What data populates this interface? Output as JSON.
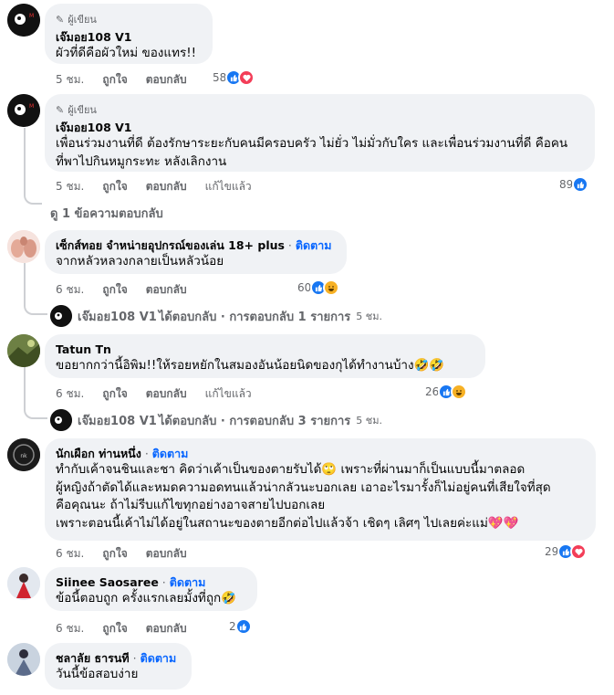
{
  "author_badge": "ผู้เขียน",
  "actions": {
    "like": "ถูกใจ",
    "reply": "ตอบกลับ",
    "edited": "แก้ไขแล้ว",
    "follow": "ติดตาม"
  },
  "comments": [
    {
      "name": "เจ๊มอย108 V1",
      "lines": [
        "ผัวที่ดีคือผัวใหม่ ของแทร!!"
      ],
      "time": "5 ชม.",
      "count": "58"
    },
    {
      "name": "เจ๊มอย108 V1",
      "lines": [
        "เพื่อนร่วมงานที่ดี ต้องรักษาระยะกับคนมีครอบครัว ไม่ยั่ว ไม่มั่วกับใคร และเพื่อนร่วมงานที่ดี คือคน",
        "ที่พาไปกินหมูกระทะ หลังเลิกงาน"
      ],
      "time": "5 ชม.",
      "count": "89"
    },
    {
      "name": "เซ็กส์ทอย จำหน่ายอุปกรณ์ของเล่น 18+ plus",
      "lines": [
        "จากหลัวหลวงกลายเป็นหลัวน้อย"
      ],
      "time": "6 ชม.",
      "count": "60"
    },
    {
      "name": "Tatun Tn",
      "lines": [
        "ขอยากกว่านี้อิพิม!!ให้รอยหยักในสมองอันน้อยนิดของกุได้ทำงานบ้าง🤣🤣"
      ],
      "time": "6 ชม.",
      "count": "26"
    },
    {
      "name": "นักเผือก ท่านหนึ่ง",
      "lines": [
        "ทำกับเค้าจนชินและชา คิดว่าเค้าเป็นของตายรับได้🙄 เพราะที่ผ่านมาก็เป็นแบบนี้มาตลอด",
        "ผู้หญิงถ้าตัดได้และหมดความอดทนแล้วน่ากลัวนะบอกเลย เอาอะไรมารั้งก็ไม่อยู่คนที่เสียใจที่สุด",
        "คือคุณนะ ถ้าไม่รีบแก้ไขทุกอย่างอาจสายไปบอกเลย",
        "เพราะตอนนี้เค้าไม่ได้อยู่ในสถานะของตายอีกต่อไปแล้วจ้า เชิดๆ เลิศๆ ไปเลยค่ะแม่💖💖"
      ],
      "time": "6 ชม.",
      "count": "29"
    },
    {
      "name": "Siinee Saosaree",
      "lines": [
        "ข้อนี้ตอบถูก ครั้งแรกเลยมั้งที่ถูก🤣"
      ],
      "time": "6 ชม.",
      "count": "2"
    },
    {
      "name": "ชลาลัย ธารนที",
      "lines": [
        "วันนี้ข้อสอบง่าย"
      ]
    }
  ],
  "view_replies": "ดู 1 ข้อความตอบกลับ",
  "reply_summaries": [
    {
      "name": "เจ๊มอย108 V1",
      "text": "ได้ตอบกลับ · การตอบกลับ 1 รายการ",
      "time": "5 ชม."
    },
    {
      "name": "เจ๊มอย108 V1",
      "text": "ได้ตอบกลับ · การตอบกลับ 3 รายการ",
      "time": "5 ชม."
    }
  ],
  "colors": {
    "like": "#1877f2",
    "love": "#f33e58",
    "haha": "#f7b125",
    "link": "#0866ff",
    "bubble": "#f0f2f5"
  }
}
